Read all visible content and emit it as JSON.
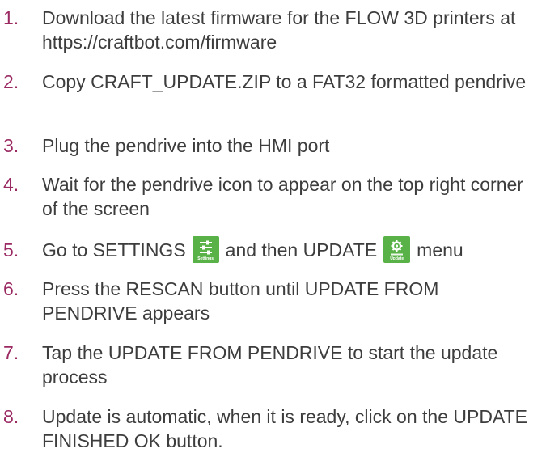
{
  "steps": [
    {
      "number": "1.",
      "text": "Download the latest firmware for the FLOW 3D printers at https://craftbot.com/firmware"
    },
    {
      "number": "2.",
      "text": "Copy CRAFT_UPDATE.ZIP to a FAT32 formatted pendrive"
    },
    {
      "number": "3.",
      "text": "Plug the pendrive into the HMI port"
    },
    {
      "number": "4.",
      "text": "Wait for the pendrive icon to appear on the top right corner of the screen"
    },
    {
      "number": "5.",
      "text_before": "Go to SETTINGS",
      "text_middle": "and then UPDATE",
      "text_after": "menu",
      "settings_icon": {
        "icon": "settings-sliders-icon",
        "caption": "Settings",
        "color": "#59b247"
      },
      "update_icon": {
        "icon": "update-gear-icon",
        "caption": "Update",
        "color": "#59b247"
      }
    },
    {
      "number": "6.",
      "text": "Press the RESCAN button until UPDATE FROM PENDRIVE appears"
    },
    {
      "number": "7.",
      "text": "Tap the UPDATE FROM PENDRIVE to start the update process"
    },
    {
      "number": "8.",
      "text": "Update is automatic, when it is ready, click on the UPDATE FINISHED OK button."
    }
  ],
  "colors": {
    "number": "#9b2a63",
    "text": "#3d3d3d",
    "icon_background": "#59b247"
  }
}
